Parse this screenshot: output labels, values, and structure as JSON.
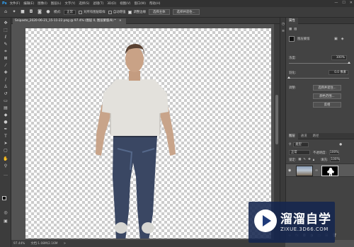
{
  "app": {
    "logo": "Ps"
  },
  "menu": [
    "文件(F)",
    "编辑(E)",
    "图像(I)",
    "图层(L)",
    "文字(Y)",
    "选择(S)",
    "滤镜(T)",
    "3D(D)",
    "视图(V)",
    "窗口(W)",
    "帮助(H)"
  ],
  "window_controls": [
    "—",
    "☐",
    "✕"
  ],
  "options_bar": {
    "style_label": "模式:",
    "style_value": "正常",
    "sample_all": "对所有图层取样",
    "auto_enhance": "自动增强",
    "edge_detect": "调整边缘",
    "select_subject": "选择主体",
    "select_mask": "选择并遮住..."
  },
  "document_tab": {
    "title": "Snipaste_2020-06-21_15-11-22.png @ 97.4% (图层 0, 图层蒙版/8) *",
    "close": "×"
  },
  "status": {
    "zoom": "97.44%",
    "doc": "文档:1.08M/2.16M",
    "arrow": ">"
  },
  "properties": {
    "tabs": [
      "属性"
    ],
    "mask_label": "图层蒙版",
    "density_label": "浓度:",
    "density_value": "100%",
    "feather_label": "羽化:",
    "feather_value": "0.0 像素",
    "refine_label": "调整:",
    "buttons": [
      "选择并遮住...",
      "颜色范围...",
      "反相"
    ],
    "density_fraction": 1.0,
    "feather_fraction": 0.0
  },
  "layers": {
    "tabs": [
      "图层",
      "通道",
      "路径"
    ],
    "filter_label": "类型",
    "blend_mode": "正常",
    "opacity_label": "不透明度:",
    "opacity_value": "100%",
    "lock_label": "锁定:",
    "fill_label": "填充:",
    "fill_value": "100%",
    "row_name": "图层 0"
  },
  "watermark": {
    "title": "溜溜自学",
    "url": "ZIXUE.3D66.COM"
  }
}
